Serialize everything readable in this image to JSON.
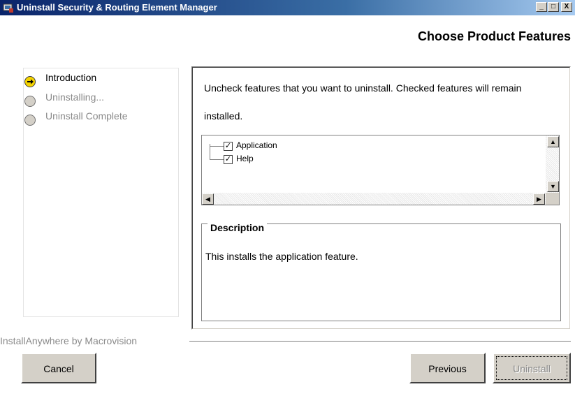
{
  "window": {
    "title": "Uninstall Security & Routing Element Manager",
    "controls": {
      "minimize": "_",
      "maximize": "□",
      "close": "X"
    }
  },
  "page_heading": "Choose Product Features",
  "steps": [
    {
      "label": "Introduction",
      "state": "active",
      "icon": "arrow-right-icon"
    },
    {
      "label": "Uninstalling...",
      "state": "pending",
      "icon": "circle-icon"
    },
    {
      "label": "Uninstall Complete",
      "state": "pending",
      "icon": "circle-icon"
    }
  ],
  "instruction": "Uncheck features that you want to uninstall. Checked features will remain installed.",
  "features": [
    {
      "label": "Application",
      "checked": true
    },
    {
      "label": "Help",
      "checked": true
    }
  ],
  "description": {
    "legend": "Description",
    "text": "This installs the application feature."
  },
  "brand": "InstallAnywhere by Macrovision",
  "buttons": {
    "cancel": "Cancel",
    "previous": "Previous",
    "uninstall": "Uninstall"
  },
  "colors": {
    "titlebar_start": "#0a246a",
    "active_step": "#f5d400",
    "button_face": "#d4d0c8",
    "disabled_text": "#8a8a8a"
  }
}
